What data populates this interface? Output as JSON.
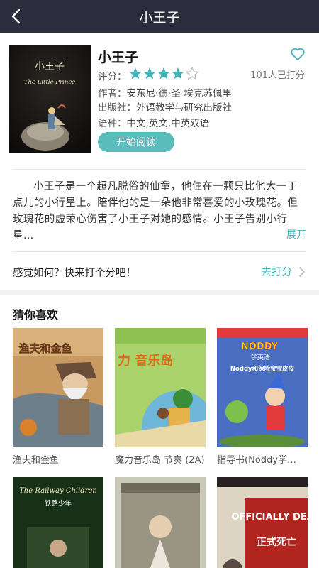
{
  "header": {
    "title": "小王子",
    "back_icon": "chevron-left-icon"
  },
  "book": {
    "title": "小王子",
    "cover_title": "小王子",
    "cover_subtitle": "The Little Prince",
    "rating_label": "评分：",
    "rating_stars": 4,
    "rating_max": 5,
    "rating_count": "101人已打分",
    "author_label": "作者：",
    "author": "安东尼·德·圣-埃克苏佩里",
    "publisher_label": "出版社：",
    "publisher": "外语教学与研究出版社",
    "language_label": "语种：",
    "language": "中文,英文,中英双语",
    "read_button": "开始阅读"
  },
  "description": {
    "text": "小王子是一个超凡脱俗的仙童，他住在一颗只比他大一丁点儿的小行星上。陪伴他的是一朵他非常喜爱的小玫瑰花。但玫瑰花的虚荣心伤害了小王子对她的感情。小王子告别小行星…",
    "expand_label": "展开"
  },
  "rate": {
    "prompt": "感觉如何？快来打个分吧！",
    "link": "去打分"
  },
  "recommendations": {
    "title": "猜你喜欢",
    "items": [
      {
        "label": "渔夫和金鱼",
        "cover_text": "渔夫和金鱼"
      },
      {
        "label": "魔力音乐岛 节奏 (2A)",
        "cover_text": "力 音乐岛"
      },
      {
        "label": "指导书(Noddy学…",
        "cover_text": "Noddy和保险宝宝皮皮",
        "cover_brand": "NODDY",
        "cover_sub": "学英语"
      },
      {
        "label": "",
        "cover_text": "The Railway Children",
        "cover_sub": "铁路少年"
      },
      {
        "label": "",
        "cover_text": ""
      },
      {
        "label": "",
        "cover_text": "OFFICIALLY DEAD",
        "cover_sub": "正式死亡"
      }
    ]
  },
  "colors": {
    "nav_bg": "#2b2d3c",
    "accent": "#43b2b7",
    "star": "#43b2b7",
    "button": "#5bbcbc"
  }
}
